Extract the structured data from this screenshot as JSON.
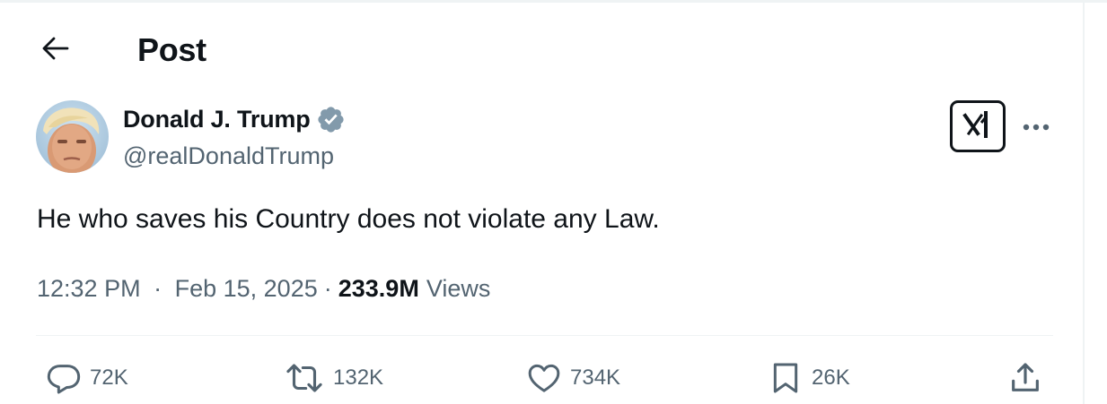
{
  "header": {
    "title": "Post",
    "back_icon": "arrow-left-icon"
  },
  "author": {
    "name": "Donald J. Trump",
    "handle": "@realDonaldTrump",
    "verified_icon": "verified-badge-icon",
    "verified_color": "#829aab"
  },
  "post": {
    "text": "He who saves his Country does not violate any Law.",
    "time": "12:32 PM",
    "separator": "·",
    "date": "Feb 15, 2025",
    "views_count": "233.9M",
    "views_label": "Views"
  },
  "actions": {
    "replies": "72K",
    "reposts": "132K",
    "likes": "734K",
    "bookmarks": "26K"
  },
  "colors": {
    "text_primary": "#0f1419",
    "text_secondary": "#536471",
    "border": "#eff3f4"
  }
}
